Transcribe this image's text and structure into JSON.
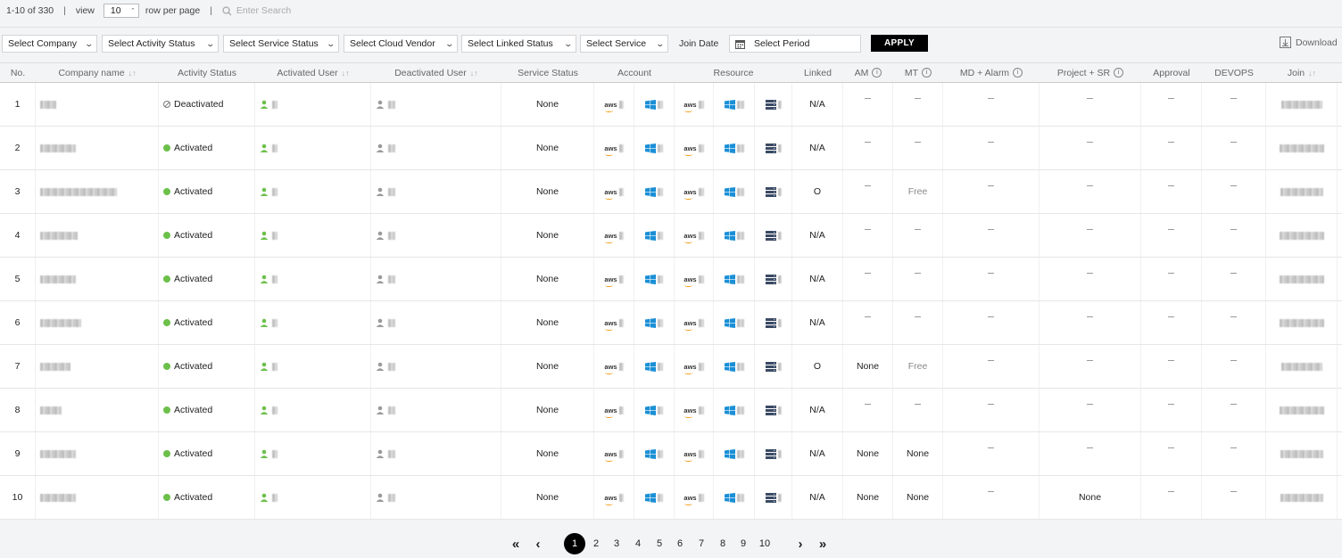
{
  "topbar": {
    "range_text": "1-10 of 330",
    "view_label": "view",
    "rows_per_page": "10",
    "rows_suffix": "row per page",
    "search_placeholder": "Enter Search"
  },
  "filters": {
    "company": "Select Company",
    "activity_status": "Select Activity Status",
    "service_status": "Select Service Status",
    "cloud_vendor": "Select Cloud Vendor",
    "linked_status": "Select Linked Status",
    "service": "Select Service",
    "join_date_label": "Join Date",
    "period_placeholder": "Select Period",
    "apply_label": "APPLY",
    "download_label": "Download"
  },
  "columns": {
    "no": "No.",
    "company": "Company name",
    "activity": "Activity Status",
    "activated": "Activated User",
    "deactivated": "Deactivated User",
    "service_status": "Service Status",
    "account": "Account",
    "resource": "Resource",
    "linked": "Linked",
    "am": "AM",
    "mt": "MT",
    "md_alarm": "MD + Alarm",
    "project_sr": "Project + SR",
    "approval": "Approval",
    "devops": "DEVOPS",
    "join": "Join",
    "sort_glyph": "↓↑",
    "info_glyph": "i"
  },
  "rows": [
    {
      "no": "1",
      "status": "Deactivated",
      "active": false,
      "service": "None",
      "linked": "N/A",
      "am": "",
      "mt": "",
      "proj": ""
    },
    {
      "no": "2",
      "status": "Activated",
      "active": true,
      "service": "None",
      "linked": "N/A",
      "am": "",
      "mt": "",
      "proj": ""
    },
    {
      "no": "3",
      "status": "Activated",
      "active": true,
      "service": "None",
      "linked": "O",
      "am": "",
      "mt": "Free",
      "proj": ""
    },
    {
      "no": "4",
      "status": "Activated",
      "active": true,
      "service": "None",
      "linked": "N/A",
      "am": "",
      "mt": "",
      "proj": ""
    },
    {
      "no": "5",
      "status": "Activated",
      "active": true,
      "service": "None",
      "linked": "N/A",
      "am": "",
      "mt": "",
      "proj": ""
    },
    {
      "no": "6",
      "status": "Activated",
      "active": true,
      "service": "None",
      "linked": "N/A",
      "am": "",
      "mt": "",
      "proj": ""
    },
    {
      "no": "7",
      "status": "Activated",
      "active": true,
      "service": "None",
      "linked": "O",
      "am": "None",
      "mt": "Free",
      "proj": ""
    },
    {
      "no": "8",
      "status": "Activated",
      "active": true,
      "service": "None",
      "linked": "N/A",
      "am": "",
      "mt": "",
      "proj": ""
    },
    {
      "no": "9",
      "status": "Activated",
      "active": true,
      "service": "None",
      "linked": "N/A",
      "am": "None",
      "mt": "None",
      "proj": ""
    },
    {
      "no": "10",
      "status": "Activated",
      "active": true,
      "service": "None",
      "linked": "N/A",
      "am": "None",
      "mt": "None",
      "proj": "None"
    }
  ],
  "account_icons": [
    "aws-icon",
    "windows-icon"
  ],
  "resource_icons": [
    "aws-icon",
    "windows-icon",
    "server-icon"
  ],
  "aws_text": "aws",
  "pagination": {
    "pages": [
      "1",
      "2",
      "3",
      "4",
      "5",
      "6",
      "7",
      "8",
      "9",
      "10"
    ],
    "current": "1",
    "first": "«",
    "prev": "‹",
    "next": "›",
    "last": "»"
  },
  "colors": {
    "active_dot": "#6cc04a",
    "windows_blue": "#1a8fd6",
    "aws_orange": "#f39c12",
    "apply_bg": "#000000"
  }
}
